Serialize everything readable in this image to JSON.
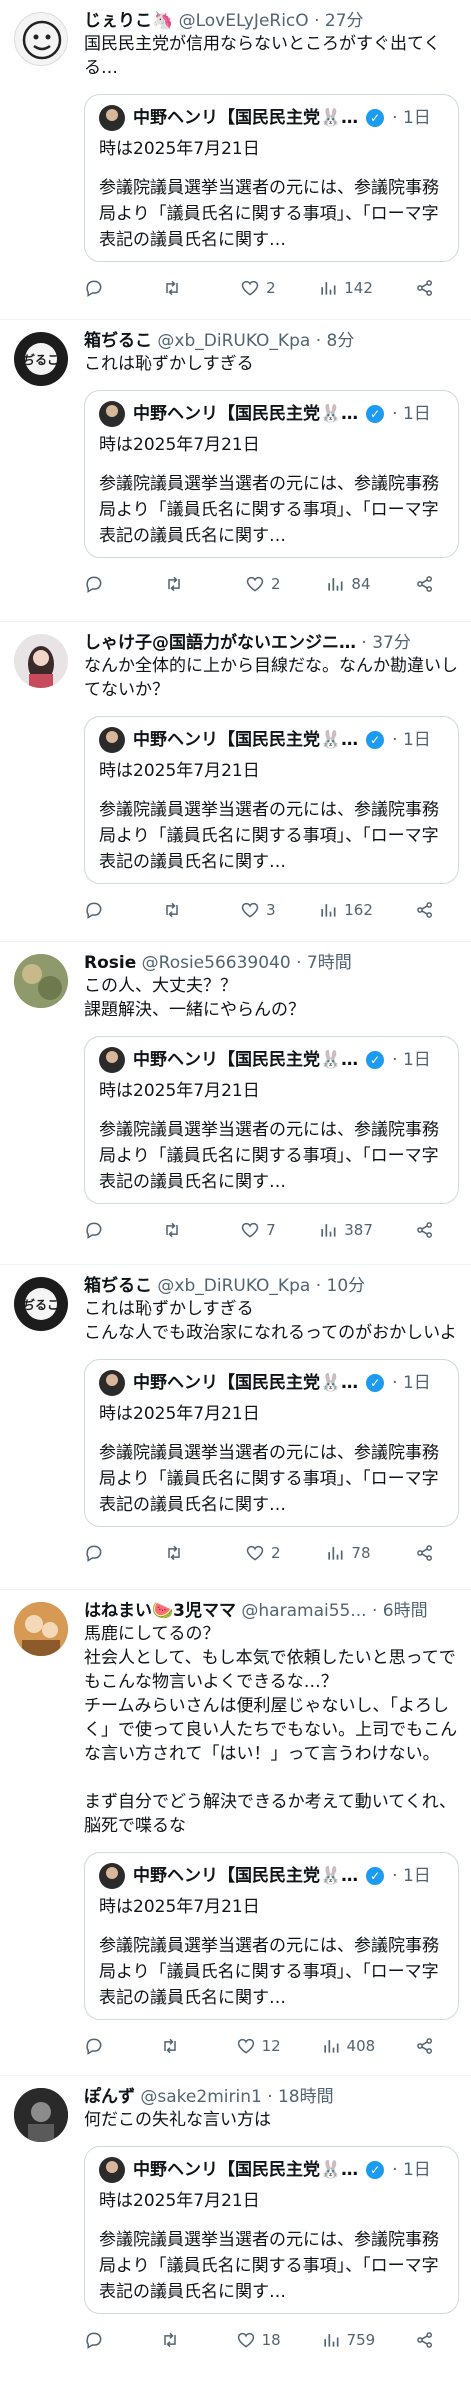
{
  "posts": [
    {
      "name": "じぇりこ🦄",
      "handle": "@LovELyJeRicO",
      "time": "· 27分",
      "text": "国民民主党が信用ならないところがすぐ出てくる…",
      "quote": {
        "name": "中野ヘンリ【国民民主党🐰…",
        "time": "· 1日",
        "date": "時は2025年7月21日",
        "text": "参議院議員選挙当選者の元には、参議院事務局より「議員氏名に関する事項」、「ローマ字表記の議員氏名に関す…"
      },
      "replies": "",
      "retweets": "",
      "likes": "2",
      "views": "142"
    },
    {
      "name": "箱ぢるこ",
      "handle": "@xb_DiRUKO_Kpa",
      "time": "· 8分",
      "text": "これは恥ずかしすぎる",
      "quote": {
        "name": "中野ヘンリ【国民民主党🐰…",
        "time": "· 1日",
        "date": "時は2025年7月21日",
        "text": "参議院議員選挙当選者の元には、参議院事務局より「議員氏名に関する事項」、「ローマ字表記の議員氏名に関す…"
      },
      "replies": "",
      "retweets": "",
      "likes": "2",
      "views": "84"
    },
    {
      "name": "しゃけ子@国語力がないエンジニ…",
      "handle": "",
      "time": "· 37分",
      "text": "なんか全体的に上から目線だな。なんか勘違いしてないか？",
      "quote": {
        "name": "中野ヘンリ【国民民主党🐰…",
        "time": "· 1日",
        "date": "時は2025年7月21日",
        "text": "参議院議員選挙当選者の元には、参議院事務局より「議員氏名に関する事項」、「ローマ字表記の議員氏名に関す…"
      },
      "replies": "",
      "retweets": "",
      "likes": "3",
      "views": "162"
    },
    {
      "name": "Rosie",
      "handle": "@Rosie56639040",
      "time": "· 7時間",
      "text": "この人、大丈夫？？\n課題解決、一緒にやらんの？",
      "quote": {
        "name": "中野ヘンリ【国民民主党🐰…",
        "time": "· 1日",
        "date": "時は2025年7月21日",
        "text": "参議院議員選挙当選者の元には、参議院事務局より「議員氏名に関する事項」、「ローマ字表記の議員氏名に関す…"
      },
      "replies": "",
      "retweets": "",
      "likes": "7",
      "views": "387"
    },
    {
      "name": "箱ぢるこ",
      "handle": "@xb_DiRUKO_Kpa",
      "time": "· 10分",
      "text": "これは恥ずかしすぎる\nこんな人でも政治家になれるってのがおかしいよ",
      "quote": {
        "name": "中野ヘンリ【国民民主党🐰…",
        "time": "· 1日",
        "date": "時は2025年7月21日",
        "text": "参議院議員選挙当選者の元には、参議院事務局より「議員氏名に関する事項」、「ローマ字表記の議員氏名に関す…"
      },
      "replies": "",
      "retweets": "",
      "likes": "2",
      "views": "78"
    },
    {
      "name": "はねまい🍉3児ママ",
      "handle": "@haramai55...",
      "time": "· 6時間",
      "text": "馬鹿にしてるの？\n社会人として、もし本気で依頼したいと思ってでもこんな物言いよくできるな…？\nチームみらいさんは便利屋じゃないし、「よろしく」で使って良い人たちでもない。上司でもこんな言い方されて「はい！」って言うわけない。\n\nまず自分でどう解決できるか考えて動いてくれ、脳死で喋るな",
      "quote": {
        "name": "中野ヘンリ【国民民主党🐰…",
        "time": "· 1日",
        "date": "時は2025年7月21日",
        "text": "参議院議員選挙当選者の元には、参議院事務局より「議員氏名に関する事項」、「ローマ字表記の議員氏名に関す…"
      },
      "replies": "",
      "retweets": "",
      "likes": "12",
      "views": "408"
    },
    {
      "name": "ぽんず",
      "handle": "@sake2mirin1",
      "time": "· 18時間",
      "text": "何だこの失礼な言い方は",
      "quote": {
        "name": "中野ヘンリ【国民民主党🐰…",
        "time": "· 1日",
        "date": "時は2025年7月21日",
        "text": "参議院議員選挙当選者の元には、参議院事務局より「議員氏名に関する事項」、「ローマ字表記の議員氏名に関す…"
      },
      "replies": "",
      "retweets": "",
      "likes": "18",
      "views": "759"
    }
  ],
  "icons": {
    "reply": "reply-icon",
    "retweet": "retweet-icon",
    "like": "heart-icon",
    "views": "views-icon",
    "share": "share-icon",
    "verified": "verified-badge-icon"
  },
  "colors": {
    "secondary_text": "#536471",
    "verified": "#1d9bf0",
    "divider": "#eff3f4",
    "quote_border": "#cfd9de"
  }
}
